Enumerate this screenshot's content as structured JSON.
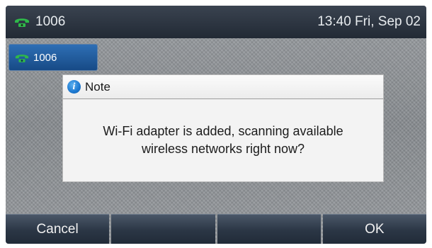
{
  "status_bar": {
    "account": "1006",
    "clock": "13:40 Fri, Sep 02",
    "icon": "phone-handset-icon"
  },
  "line_key": {
    "label": "1006",
    "icon": "phone-handset-icon",
    "color": "#1f5ea3"
  },
  "dialog": {
    "title": "Note",
    "title_icon": "info-icon",
    "message_line1": "Wi-Fi adapter is added, scanning available",
    "message_line2": "wireless networks right now?"
  },
  "softkeys": [
    {
      "label": "Cancel"
    },
    {
      "label": ""
    },
    {
      "label": ""
    },
    {
      "label": "OK"
    }
  ],
  "colors": {
    "status_bar_bg": "#2c3440",
    "line_key_bg": "#1f5ea3",
    "softkey_bg": "#2b3645",
    "phone_icon": "#2fb84a",
    "dialog_bg": "#f3f3f3"
  }
}
